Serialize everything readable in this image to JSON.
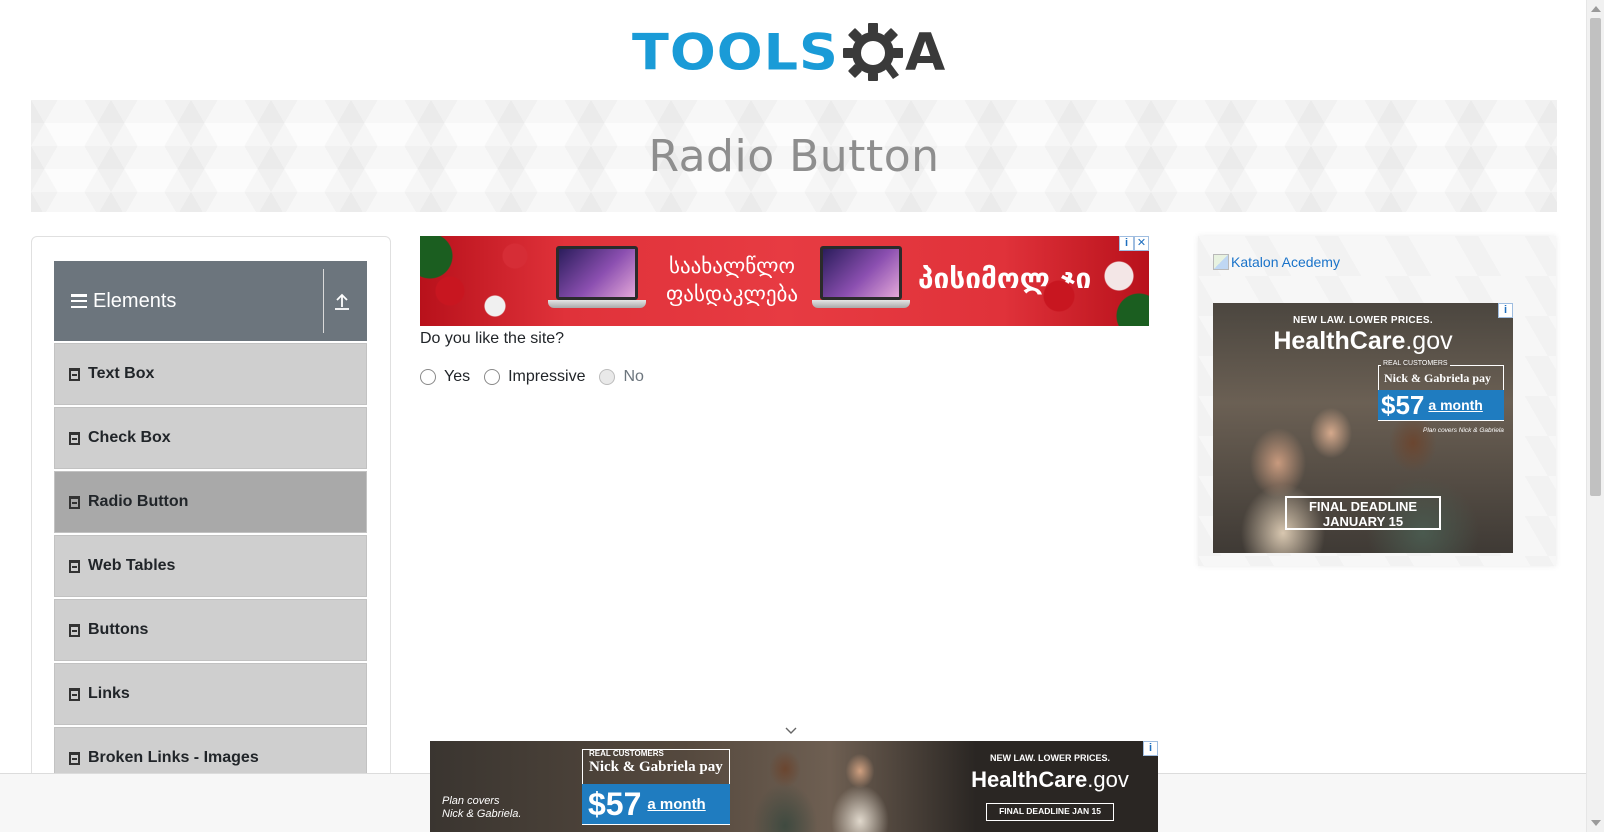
{
  "header": {
    "logo_tools": "TOOLS",
    "logo_a": "A"
  },
  "banner": {
    "title": "Radio Button"
  },
  "sidebar": {
    "group_title": "Elements",
    "items": [
      {
        "label": "Text Box",
        "active": false
      },
      {
        "label": "Check Box",
        "active": false
      },
      {
        "label": "Radio Button",
        "active": true
      },
      {
        "label": "Web Tables",
        "active": false
      },
      {
        "label": "Buttons",
        "active": false
      },
      {
        "label": "Links",
        "active": false
      },
      {
        "label": "Broken Links - Images",
        "active": false
      }
    ]
  },
  "top_ad": {
    "text_mid": "საახალწლო ფასდაკლება",
    "text_right": "პისიმოლ.ჯი"
  },
  "main": {
    "question": "Do you like the site?",
    "options": [
      {
        "label": "Yes",
        "selected": false,
        "disabled": false
      },
      {
        "label": "Impressive",
        "selected": false,
        "disabled": false
      },
      {
        "label": "No",
        "selected": false,
        "disabled": true
      }
    ]
  },
  "right_ad": {
    "katalon_alt": "Katalon Acedemy",
    "tagline": "NEW LAW. LOWER PRICES.",
    "brand_main": "HealthCare",
    "brand_suffix": ".gov",
    "real_customers": "REAL CUSTOMERS",
    "nick": "Nick & Gabriela pay",
    "price": "$57",
    "month": "a month",
    "covers": "Plan covers Nick & Gabriela",
    "deadline_line1": "FINAL DEADLINE",
    "deadline_line2": "JANUARY 15"
  },
  "bottom_ad": {
    "covers_line1": "Plan covers",
    "covers_line2": "Nick & Gabriela.",
    "real_customers": "REAL CUSTOMERS",
    "nick": "Nick & Gabriela pay",
    "price": "$57",
    "month": "a month",
    "tagline": "NEW LAW. LOWER PRICES.",
    "brand_main": "HealthCare",
    "brand_suffix": ".gov",
    "deadline": "FINAL DEADLINE JAN 15"
  },
  "colors": {
    "logo_blue": "#1a9bd7",
    "sidebar_header": "#6c757d",
    "menu_item": "#cfcfcf",
    "menu_item_active": "#a9a9a9",
    "ad_red": "#e73b42"
  }
}
